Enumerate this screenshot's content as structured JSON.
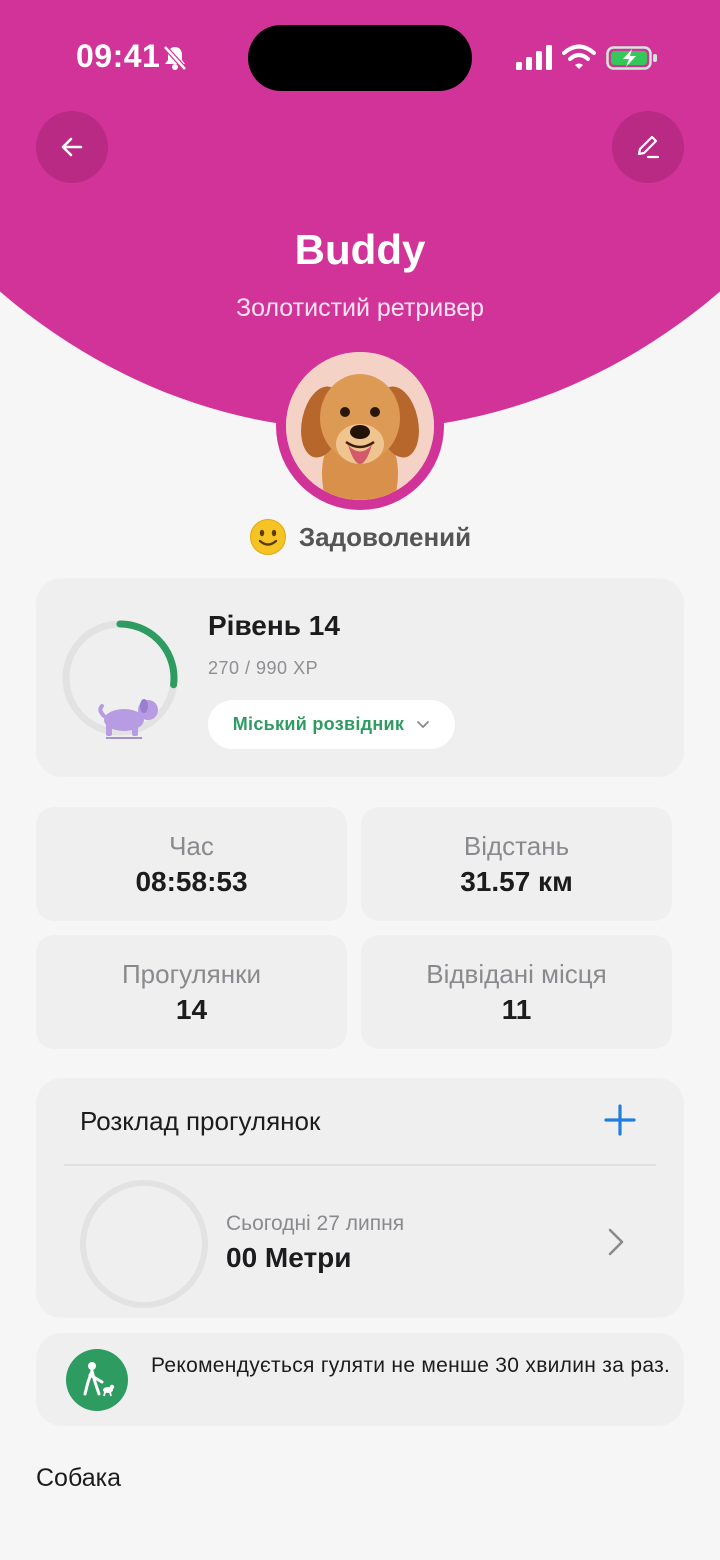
{
  "status_bar": {
    "time": "09:41"
  },
  "header": {
    "pet_name": "Buddy",
    "pet_breed": "Золотистий ретривер",
    "back_icon": "arrow-left-icon",
    "edit_icon": "pencil-icon",
    "background_color": "#d23398"
  },
  "mood": {
    "emoji": "🙂",
    "label": "Задоволений"
  },
  "level": {
    "title": "Рівень 14",
    "xp_text": "270 / 990 XP",
    "xp_progress": 0.27,
    "rank": "Міський розвідник",
    "accent_color": "#2e9b61"
  },
  "stats": [
    {
      "label": "Час",
      "value": "08:58:53"
    },
    {
      "label": "Відстань",
      "value": "31.57 км"
    },
    {
      "label": "Прогулянки",
      "value": "14"
    },
    {
      "label": "Відвідані місця",
      "value": "11"
    }
  ],
  "schedule": {
    "title": "Розклад прогулянок",
    "add_icon": "plus-icon",
    "date": "Сьогодні 27 липня",
    "meters": "00 Метри"
  },
  "tip": {
    "text": "Рекомендується гуляти не менше 30 хвилин за раз."
  },
  "section_label": "Собака"
}
